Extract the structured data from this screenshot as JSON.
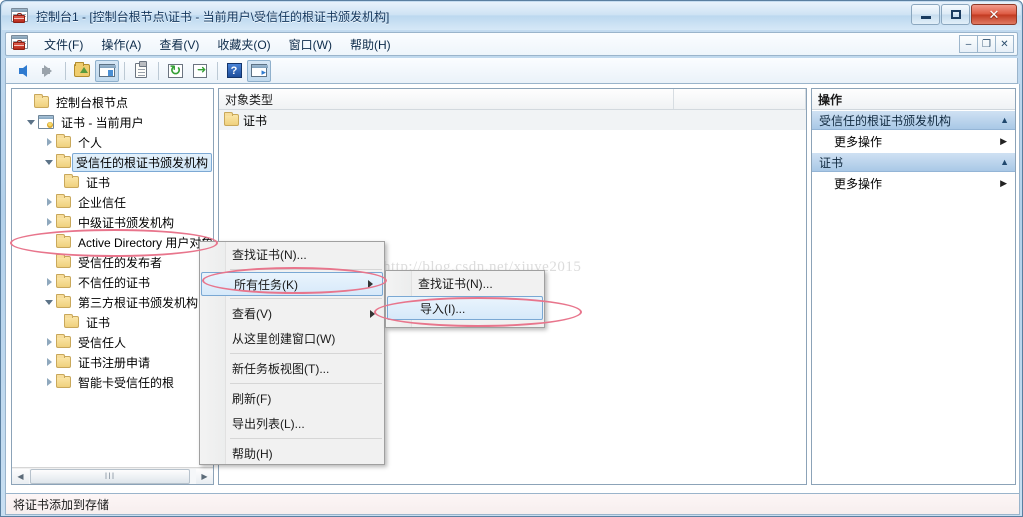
{
  "window": {
    "title": "控制台1 - [控制台根节点\\证书 - 当前用户\\受信任的根证书颁发机构]",
    "icon": "mmc-console-icon",
    "buttons": {
      "minimize": "minimize-icon",
      "maximize": "maximize-icon",
      "close": "✕"
    },
    "mdi_buttons": {
      "minimize": "–",
      "restore": "❐",
      "close": "✕"
    }
  },
  "menu_bar": {
    "icon": "mmc-console-icon",
    "items": [
      {
        "label": "文件(F)",
        "name": "menu-file"
      },
      {
        "label": "操作(A)",
        "name": "menu-action"
      },
      {
        "label": "查看(V)",
        "name": "menu-view"
      },
      {
        "label": "收藏夹(O)",
        "name": "menu-favorites"
      },
      {
        "label": "窗口(W)",
        "name": "menu-window"
      },
      {
        "label": "帮助(H)",
        "name": "menu-help"
      }
    ]
  },
  "toolbar": {
    "items": [
      {
        "name": "back-arrow-icon",
        "kind": "back"
      },
      {
        "name": "forward-arrow-icon",
        "kind": "forward"
      },
      {
        "name": "up-one-level-folder-icon",
        "kind": "folderup"
      },
      {
        "name": "show-hide-console-tree-icon",
        "kind": "tree",
        "pressed": true
      },
      {
        "name": "properties-clipboard-icon",
        "kind": "clip"
      },
      {
        "name": "refresh-icon",
        "kind": "refresh"
      },
      {
        "name": "export-list-icon",
        "kind": "export"
      },
      {
        "name": "help-icon",
        "kind": "help"
      },
      {
        "name": "show-action-pane-icon",
        "kind": "actionpane"
      }
    ]
  },
  "tree": {
    "items": [
      {
        "label": "控制台根节点",
        "indent": 0,
        "expander": "none",
        "icon": "folder",
        "selected": false
      },
      {
        "label": "证书 - 当前用户",
        "indent": 1,
        "expander": "expanded",
        "icon": "certstore",
        "selected": false
      },
      {
        "label": "个人",
        "indent": 2,
        "expander": "collapsed",
        "icon": "folder",
        "selected": false
      },
      {
        "label": "受信任的根证书颁发机构",
        "indent": 2,
        "expander": "expanded",
        "icon": "folder",
        "selected": true
      },
      {
        "label": "证书",
        "indent": 3,
        "expander": "none",
        "icon": "folder",
        "selected": false
      },
      {
        "label": "企业信任",
        "indent": 2,
        "expander": "collapsed",
        "icon": "folder",
        "selected": false
      },
      {
        "label": "中级证书颁发机构",
        "indent": 2,
        "expander": "collapsed",
        "icon": "folder",
        "selected": false
      },
      {
        "label": "Active Directory 用户对象",
        "indent": 2,
        "expander": "none",
        "icon": "folder",
        "selected": false
      },
      {
        "label": "受信任的发布者",
        "indent": 2,
        "expander": "none",
        "icon": "folder",
        "selected": false
      },
      {
        "label": "不信任的证书",
        "indent": 2,
        "expander": "collapsed",
        "icon": "folder",
        "selected": false
      },
      {
        "label": "第三方根证书颁发机构",
        "indent": 2,
        "expander": "expanded",
        "icon": "folder",
        "selected": false
      },
      {
        "label": "证书",
        "indent": 3,
        "expander": "none",
        "icon": "folder",
        "selected": false
      },
      {
        "label": "受信任人",
        "indent": 2,
        "expander": "collapsed",
        "icon": "folder",
        "selected": false
      },
      {
        "label": "证书注册申请",
        "indent": 2,
        "expander": "collapsed",
        "icon": "folder",
        "selected": false
      },
      {
        "label": "智能卡受信任的根",
        "indent": 2,
        "expander": "collapsed",
        "icon": "folder",
        "selected": false
      }
    ],
    "hscroll": {
      "left_arrow": "◀",
      "right_arrow": "▶",
      "thumb_grip": "III"
    }
  },
  "list": {
    "columns": [
      "对象类型"
    ],
    "rows": [
      {
        "icon": "folder",
        "object_type": "证书"
      }
    ],
    "watermark": "http://blog.csdn.net/xiuye2015"
  },
  "actions": {
    "title": "操作",
    "groups": [
      {
        "header": "受信任的根证书颁发机构",
        "collapse_chevron": "▲",
        "items": [
          {
            "label": "更多操作",
            "arrow": "▶"
          }
        ]
      },
      {
        "header": "证书",
        "collapse_chevron": "▲",
        "items": [
          {
            "label": "更多操作",
            "arrow": "▶"
          }
        ]
      }
    ]
  },
  "context_menu": {
    "items": [
      {
        "label": "查找证书(N)...",
        "submenu": false,
        "highlight": false,
        "type": "item"
      },
      {
        "type": "separator"
      },
      {
        "label": "所有任务(K)",
        "submenu": true,
        "highlight": true,
        "type": "item"
      },
      {
        "type": "separator"
      },
      {
        "label": "查看(V)",
        "submenu": true,
        "highlight": false,
        "type": "item"
      },
      {
        "label": "从这里创建窗口(W)",
        "submenu": false,
        "highlight": false,
        "type": "item"
      },
      {
        "type": "separator"
      },
      {
        "label": "新任务板视图(T)...",
        "submenu": false,
        "highlight": false,
        "type": "item"
      },
      {
        "type": "separator"
      },
      {
        "label": "刷新(F)",
        "submenu": false,
        "highlight": false,
        "type": "item"
      },
      {
        "label": "导出列表(L)...",
        "submenu": false,
        "highlight": false,
        "type": "item"
      },
      {
        "type": "separator"
      },
      {
        "label": "帮助(H)",
        "submenu": false,
        "highlight": false,
        "type": "item"
      }
    ]
  },
  "context_submenu": {
    "items": [
      {
        "label": "查找证书(N)...",
        "highlight": false
      },
      {
        "label": "导入(I)...",
        "highlight": true
      }
    ]
  },
  "annotations": {
    "color": "#e8758c",
    "shapes": [
      {
        "name": "highlight-tree-node",
        "target": "受信任的根证书颁发机构"
      },
      {
        "name": "highlight-all-tasks",
        "target": "所有任务(K)"
      },
      {
        "name": "highlight-import",
        "target": "导入(I)..."
      }
    ]
  },
  "status_bar": {
    "text": "将证书添加到存储"
  }
}
